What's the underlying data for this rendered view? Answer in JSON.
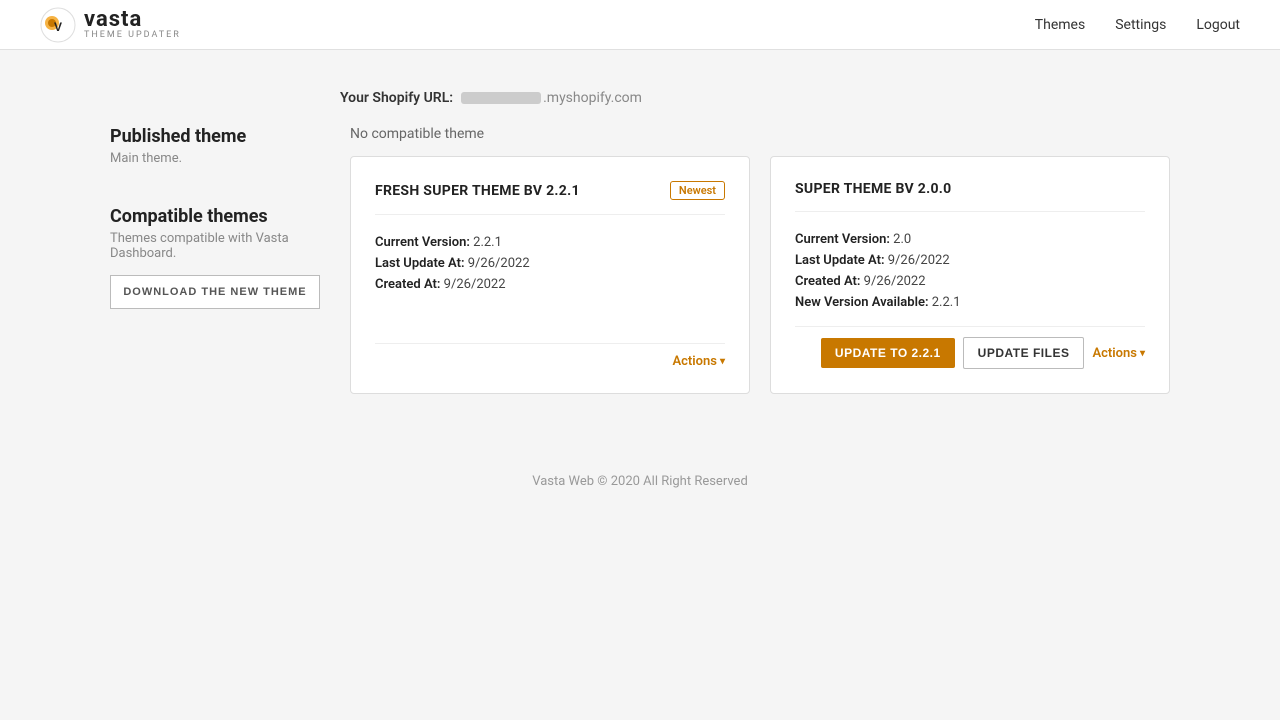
{
  "header": {
    "logo_name": "vasta",
    "logo_sub": "THEME UPDATER",
    "nav": {
      "themes_label": "Themes",
      "settings_label": "Settings",
      "logout_label": "Logout"
    }
  },
  "shopify_url": {
    "label": "Your Shopify URL:",
    "suffix": ".myshopify.com"
  },
  "sidebar": {
    "published_title": "Published theme",
    "published_sub": "Main theme.",
    "compatible_title": "Compatible themes",
    "compatible_sub": "Themes compatible with Vasta Dashboard.",
    "download_btn_label": "DOWNLOAD THE NEW THEME"
  },
  "no_compatible": "No compatible theme",
  "themes": [
    {
      "name": "FRESH SUPER THEME BV 2.2.1",
      "newest": true,
      "newest_label": "Newest",
      "current_version_label": "Current Version:",
      "current_version": "2.2.1",
      "last_update_label": "Last Update At:",
      "last_update": "9/26/2022",
      "created_label": "Created At:",
      "created": "9/26/2022",
      "new_version_available_label": null,
      "new_version_available": null,
      "actions_label": "Actions"
    },
    {
      "name": "SUPER THEME BV 2.0.0",
      "newest": false,
      "newest_label": null,
      "current_version_label": "Current Version:",
      "current_version": "2.0",
      "last_update_label": "Last Update At:",
      "last_update": "9/26/2022",
      "created_label": "Created At:",
      "created": "9/26/2022",
      "new_version_available_label": "New Version Available:",
      "new_version_available": "2.2.1",
      "update_btn_label": "UPDATE TO 2.2.1",
      "update_files_btn_label": "UPDATE FILES",
      "actions_label": "Actions"
    }
  ],
  "footer": {
    "text": "Vasta Web © 2020 All Right Reserved"
  }
}
